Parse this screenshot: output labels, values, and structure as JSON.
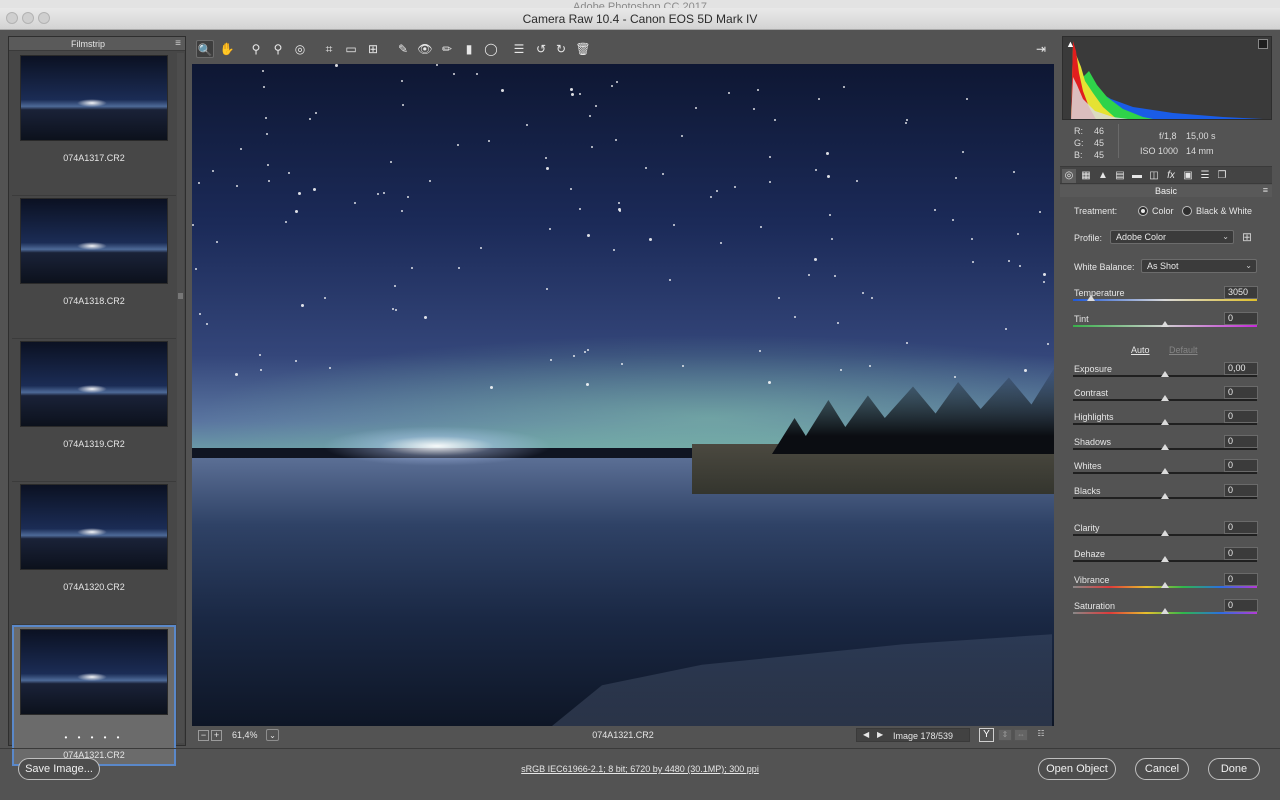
{
  "window": {
    "app_title": "Adobe Photoshop CC 2017",
    "title": "Camera Raw 10.4  -  Canon EOS 5D Mark IV"
  },
  "toolbar": {
    "tools": [
      {
        "name": "zoom-tool",
        "glyph": "🔍"
      },
      {
        "name": "hand-tool",
        "glyph": "✋"
      },
      {
        "name": "white-balance-tool",
        "glyph": "⚲"
      },
      {
        "name": "color-sampler-tool",
        "glyph": "⚲"
      },
      {
        "name": "targeted-adjustment-tool",
        "glyph": "◎"
      },
      {
        "name": "crop-tool",
        "glyph": "⌗"
      },
      {
        "name": "straighten-tool",
        "glyph": "▭"
      },
      {
        "name": "transform-tool",
        "glyph": "⊞"
      },
      {
        "name": "spot-removal-tool",
        "glyph": "✎"
      },
      {
        "name": "red-eye-tool",
        "glyph": "👁"
      },
      {
        "name": "adjustment-brush-tool",
        "glyph": "✏"
      },
      {
        "name": "graduated-filter-tool",
        "glyph": "▮"
      },
      {
        "name": "radial-filter-tool",
        "glyph": "◯"
      },
      {
        "name": "preferences-button",
        "glyph": "☰"
      },
      {
        "name": "rotate-ccw-button",
        "glyph": "↺"
      },
      {
        "name": "rotate-cw-button",
        "glyph": "↻"
      },
      {
        "name": "delete-button",
        "glyph": "🗑"
      }
    ],
    "fullscreen_glyph": "⇥"
  },
  "filmstrip": {
    "title": "Filmstrip",
    "menu_glyph": "≡",
    "items": [
      {
        "name": "074A1317.CR2"
      },
      {
        "name": "074A1318.CR2"
      },
      {
        "name": "074A1319.CR2"
      },
      {
        "name": "074A1320.CR2"
      },
      {
        "name": "074A1321.CR2",
        "rating_dots": "• • • • •"
      }
    ]
  },
  "preview": {
    "zoom_minus": "−",
    "zoom_plus": "+",
    "zoom": "61,4%",
    "zoom_dropdown": "⌄",
    "filename": "074A1321.CR2",
    "nav_prev": "◀",
    "nav_next": "▶",
    "image_count": "Image 178/539",
    "compare_icon": "Y"
  },
  "readout": {
    "r_label": "R:",
    "r": "46",
    "g_label": "G:",
    "g": "45",
    "b_label": "B:",
    "b": "45",
    "aperture": "f/1,8",
    "shutter": "15,00 s",
    "iso": "ISO 1000",
    "focal": "14 mm"
  },
  "panel": {
    "section_title": "Basic",
    "treatment_label": "Treatment:",
    "treatment_color": "Color",
    "treatment_bw": "Black & White",
    "profile_label": "Profile:",
    "profile_value": "Adobe Color",
    "wb_label": "White Balance:",
    "wb_value": "As Shot",
    "auto_label": "Auto",
    "default_label": "Default",
    "sliders": [
      {
        "label": "Temperature",
        "value": "3050",
        "level": 0.1,
        "track": "temp"
      },
      {
        "label": "Tint",
        "value": "0",
        "level": 0.5,
        "track": "tint"
      },
      {
        "label": "Exposure",
        "value": "0,00",
        "level": 0.5,
        "track": "plain"
      },
      {
        "label": "Contrast",
        "value": "0",
        "level": 0.5,
        "track": "plain"
      },
      {
        "label": "Highlights",
        "value": "0",
        "level": 0.5,
        "track": "plain"
      },
      {
        "label": "Shadows",
        "value": "0",
        "level": 0.5,
        "track": "plain"
      },
      {
        "label": "Whites",
        "value": "0",
        "level": 0.5,
        "track": "plain"
      },
      {
        "label": "Blacks",
        "value": "0",
        "level": 0.5,
        "track": "plain"
      },
      {
        "label": "Clarity",
        "value": "0",
        "level": 0.5,
        "track": "plain"
      },
      {
        "label": "Dehaze",
        "value": "0",
        "level": 0.5,
        "track": "plain"
      },
      {
        "label": "Vibrance",
        "value": "0",
        "level": 0.5,
        "track": "sat"
      },
      {
        "label": "Saturation",
        "value": "0",
        "level": 0.5,
        "track": "sat"
      }
    ]
  },
  "footer": {
    "save_label": "Save Image...",
    "workflow_link": "sRGB IEC61966-2.1; 8 bit; 6720 by 4480 (30.1MP); 300 ppi",
    "open_label": "Open Object",
    "cancel_label": "Cancel",
    "done_label": "Done"
  },
  "colors": {
    "panel_bg": "#535353",
    "accent_selection": "#5a88c9"
  }
}
